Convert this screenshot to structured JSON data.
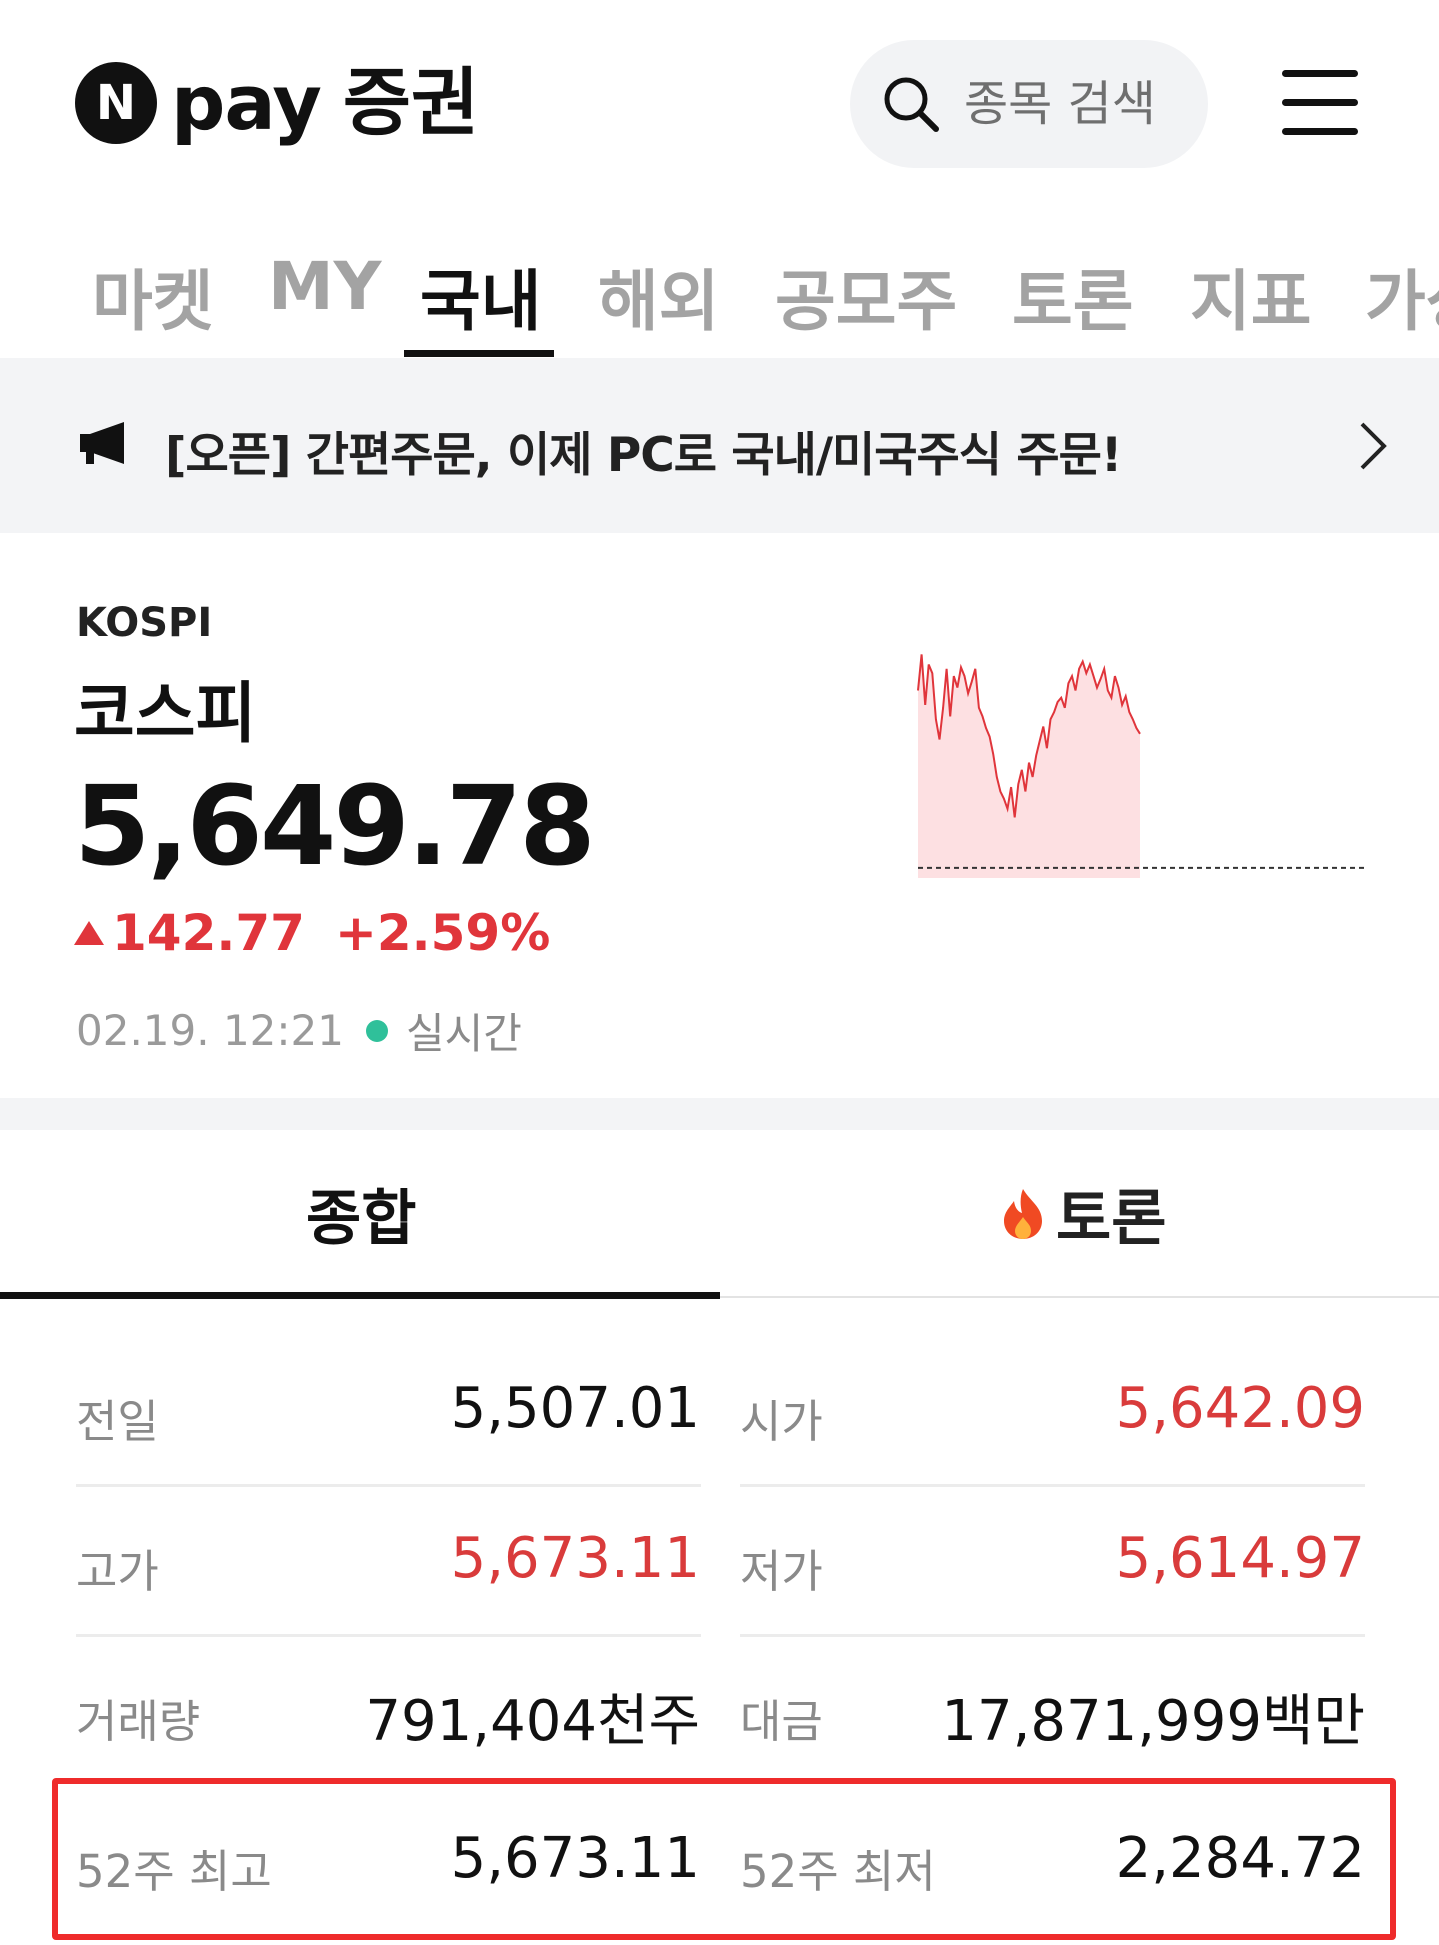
{
  "header": {
    "logo_mark": "N",
    "logo_pay": "pay",
    "logo_brand": "증권",
    "search_placeholder": "종목 검색"
  },
  "tabs": [
    {
      "label": "마켓",
      "active": false
    },
    {
      "label": "MY",
      "active": false
    },
    {
      "label": "국내",
      "active": true
    },
    {
      "label": "해외",
      "active": false
    },
    {
      "label": "공모주",
      "active": false
    },
    {
      "label": "토론",
      "active": false
    },
    {
      "label": "지표",
      "active": false
    },
    {
      "label": "가상",
      "active": false
    }
  ],
  "notice": {
    "text": "[오픈] 간편주문, 이제 PC로 국내/미국주식 주문!"
  },
  "index": {
    "code": "KOSPI",
    "name": "코스피",
    "price": "5,649.78",
    "change": "142.77",
    "change_pct": "+2.59%",
    "time": "02.19. 12:21",
    "live_label": "실시간",
    "up_color": "#e0353b",
    "live_color": "#2fc09a"
  },
  "mini_chart": {
    "values": [
      5630,
      5655,
      5620,
      5648,
      5642,
      5610,
      5596,
      5618,
      5645,
      5612,
      5640,
      5632,
      5646,
      5640,
      5628,
      5636,
      5645,
      5618,
      5612,
      5604,
      5598,
      5586,
      5570,
      5560,
      5555,
      5548,
      5563,
      5542,
      5565,
      5575,
      5560,
      5580,
      5570,
      5585,
      5595,
      5605,
      5590,
      5610,
      5615,
      5622,
      5625,
      5618,
      5635,
      5640,
      5630,
      5645,
      5650,
      5642,
      5648,
      5640,
      5632,
      5638,
      5645,
      5630,
      5625,
      5640,
      5632,
      5620,
      5626,
      5615,
      5610,
      5604,
      5600
    ],
    "ymin": 5500,
    "ymax": 5665,
    "prev_close_ref": 5507.01,
    "line_color": "#e0353b",
    "fill_color": "#fde0e2"
  },
  "subtabs": {
    "total": "종합",
    "talk": "토론"
  },
  "stats": {
    "prev_label": "전일",
    "prev_value": "5,507.01",
    "open_label": "시가",
    "open_value": "5,642.09",
    "high_label": "고가",
    "high_value": "5,673.11",
    "low_label": "저가",
    "low_value": "5,614.97",
    "volume_label": "거래량",
    "volume_value": "791,404천주",
    "amount_label": "대금",
    "amount_value": "17,871,999백만",
    "w52_high_label": "52주 최고",
    "w52_high_value": "5,673.11",
    "w52_low_label": "52주 최저",
    "w52_low_value": "2,284.72"
  }
}
